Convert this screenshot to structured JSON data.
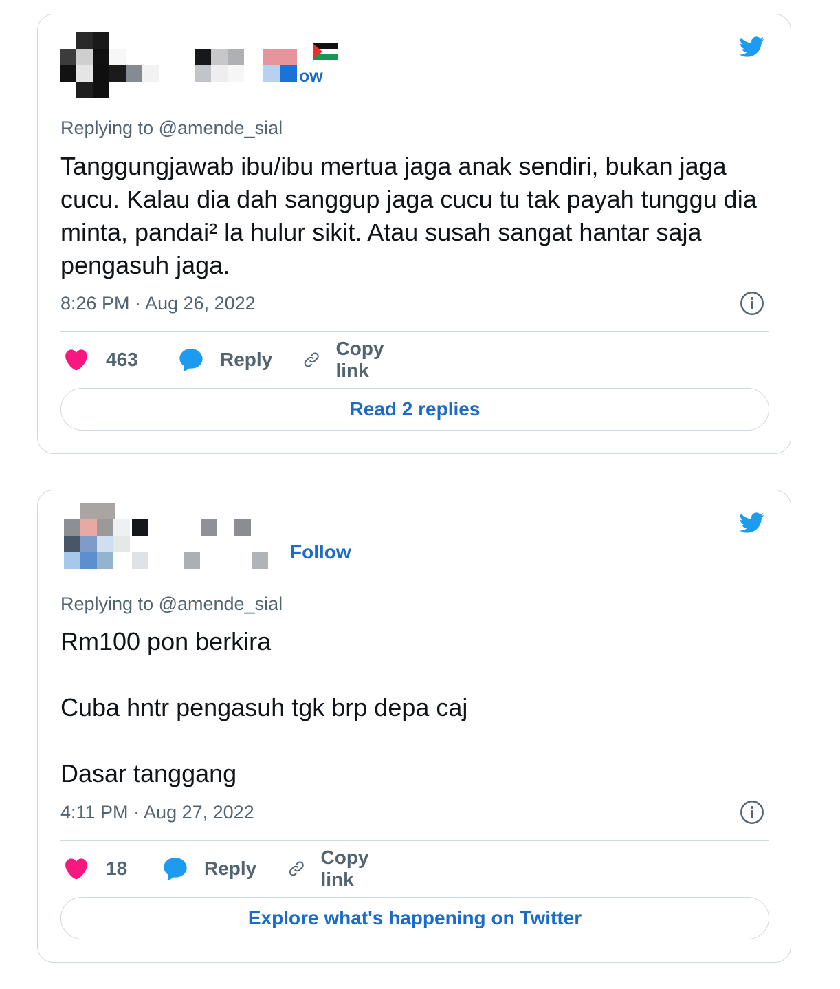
{
  "colors": {
    "accent": "#1d6bc8",
    "twitter_blue": "#1d9bf0",
    "like_pink": "#f91880",
    "muted_text": "#536471",
    "border": "#cfd9de"
  },
  "tweets": [
    {
      "author_redacted": true,
      "name_emoji": "🇵🇸",
      "follow_label": "ow",
      "replying_to": "Replying to @amende_sial",
      "text_paragraphs": [
        "Tanggungjawab ibu/ibu mertua jaga anak sendiri, bukan jaga cucu. Kalau dia dah sanggup jaga cucu tu tak payah tunggu dia minta, pandai² la hulur sikit. Atau susah sangat hantar saja pengasuh jaga."
      ],
      "timestamp": "8:26 PM · Aug 26, 2022",
      "likes": "463",
      "reply_label": "Reply",
      "copy_link_label": "Copy link",
      "footer_button": "Read 2 replies",
      "icons": [
        "twitter-bird-icon",
        "info-icon",
        "heart-icon",
        "reply-bubble-icon",
        "link-icon"
      ]
    },
    {
      "author_redacted": true,
      "follow_label": "Follow",
      "replying_to": "Replying to @amende_sial",
      "text_paragraphs": [
        "Rm100 pon berkira",
        "Cuba hntr pengasuh tgk brp depa caj",
        "Dasar tanggang"
      ],
      "timestamp": "4:11 PM · Aug 27, 2022",
      "likes": "18",
      "reply_label": "Reply",
      "copy_link_label": "Copy link",
      "footer_button": "Explore what's happening on Twitter",
      "icons": [
        "twitter-bird-icon",
        "info-icon",
        "heart-icon",
        "reply-bubble-icon",
        "link-icon"
      ]
    }
  ]
}
